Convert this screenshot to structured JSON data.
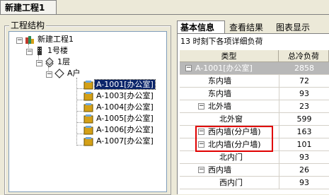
{
  "window_tab": "新建工程1",
  "left": {
    "group_title": "工程结构",
    "tree": [
      {
        "label": "新建工程1",
        "icon": "project-icon"
      },
      {
        "label": "1号楼",
        "icon": "building-icon"
      },
      {
        "label": "1层",
        "icon": "floor-icon"
      },
      {
        "label": "A户",
        "icon": "unit-icon"
      },
      {
        "label": "A-1001[办公室]",
        "icon": "room-icon",
        "selected": true
      },
      {
        "label": "A-1003[办公室]",
        "icon": "room-icon"
      },
      {
        "label": "A-1004[办公室]",
        "icon": "room-icon"
      },
      {
        "label": "A-1005[办公室]",
        "icon": "room-icon"
      },
      {
        "label": "A-1006[办公室]",
        "icon": "room-icon"
      },
      {
        "label": "A-1007[办公室]",
        "icon": "room-icon"
      }
    ]
  },
  "right": {
    "tabs": [
      "基本信息",
      "查看结果",
      "图表显示"
    ],
    "active_tab": "基本信息",
    "caption": "13 时刻下各项详细负荷",
    "columns": [
      "类型",
      "总冷负荷"
    ],
    "rows": [
      {
        "type": "A-1001[办公室]",
        "load": "2858"
      },
      {
        "type": "东内墙",
        "load": "72"
      },
      {
        "type": "东内墙",
        "load": "93"
      },
      {
        "type": "北外墙",
        "load": "23"
      },
      {
        "type": "北外窗",
        "load": "599"
      },
      {
        "type": "西内墙(分户墙)",
        "load": "163"
      },
      {
        "type": "北内墙(分户墙)",
        "load": "101"
      },
      {
        "type": "北内门",
        "load": "93"
      },
      {
        "type": "西内墙",
        "load": "26"
      },
      {
        "type": "西内门",
        "load": "93"
      }
    ]
  },
  "colors": {
    "selection": "#0a246a",
    "highlight_row": "#b8b8b8",
    "annotation_box": "#e00000"
  }
}
